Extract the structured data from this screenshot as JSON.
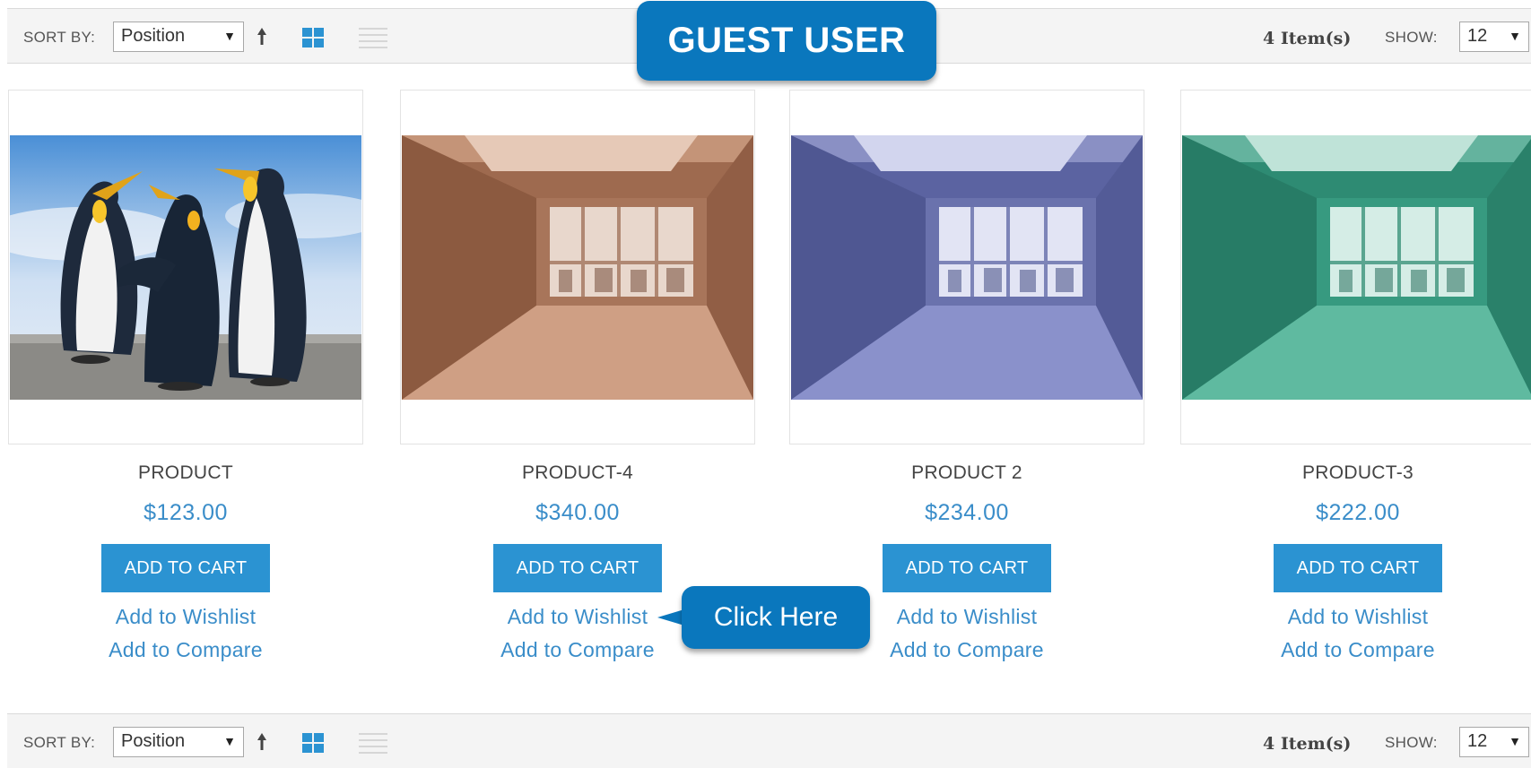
{
  "toolbar": {
    "sort_label": "SORT BY:",
    "sort_value": "Position",
    "items_count": "4 Item(s)",
    "show_label": "SHOW:",
    "show_value": "12",
    "sort_direction_icon": "arrow-up-icon",
    "grid_icon": "grid-view-icon",
    "list_icon": "list-view-icon"
  },
  "badge": {
    "text": "GUEST USER",
    "color": "#0a77bd"
  },
  "callout": {
    "text": "Click Here"
  },
  "products": [
    {
      "name": "PRODUCT",
      "price": "$123.00",
      "cart_label": "ADD TO CART",
      "wishlist_label": "Add to Wishlist",
      "compare_label": "Add to Compare"
    },
    {
      "name": "PRODUCT-4",
      "price": "$340.00",
      "cart_label": "ADD TO CART",
      "wishlist_label": "Add to Wishlist",
      "compare_label": "Add to Compare"
    },
    {
      "name": "PRODUCT 2",
      "price": "$234.00",
      "cart_label": "ADD TO CART",
      "wishlist_label": "Add to Wishlist",
      "compare_label": "Add to Compare"
    },
    {
      "name": "PRODUCT-3",
      "price": "$222.00",
      "cart_label": "ADD TO CART",
      "wishlist_label": "Add to Wishlist",
      "compare_label": "Add to Compare"
    }
  ],
  "colors": {
    "accent": "#2b93d2",
    "link": "#3a8dc9",
    "callout": "#0a77bd"
  }
}
